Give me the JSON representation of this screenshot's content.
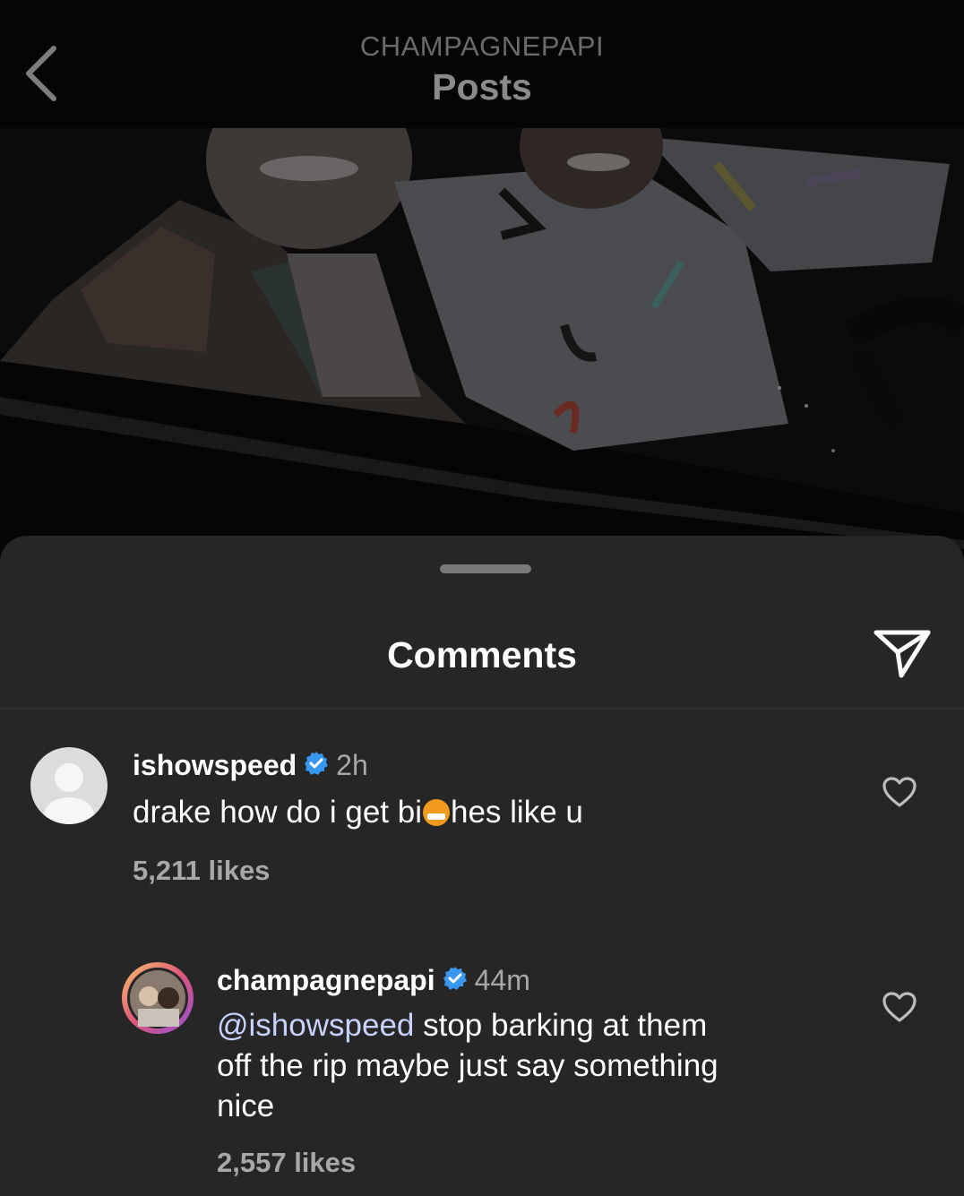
{
  "header": {
    "account": "CHAMPAGNEPAPI",
    "title": "Posts"
  },
  "sheet": {
    "title": "Comments"
  },
  "comments": [
    {
      "username": "ishowspeed",
      "verified": true,
      "time": "2h",
      "text_before_emoji": "drake how do i get bi",
      "emoji": "grimacing-censored-emoji",
      "text_after_emoji": "hes like u",
      "likes": "5,211 likes"
    }
  ],
  "reply": {
    "username": "champagnepapi",
    "verified": true,
    "time": "44m",
    "mention": "@ishowspeed",
    "text_line1": " stop barking at them",
    "text_line2": "off the rip maybe just say something",
    "text_line3": "nice",
    "likes": "2,557 likes"
  },
  "icons": {
    "back": "chevron-left-icon",
    "share": "paper-plane-icon",
    "like": "heart-outline-icon",
    "verified": "verified-badge-icon"
  },
  "colors": {
    "sheet_bg": "#262626",
    "verified_blue": "#3897f0",
    "muted_text": "#a8a8a8",
    "mention": "#c7d2ff"
  }
}
